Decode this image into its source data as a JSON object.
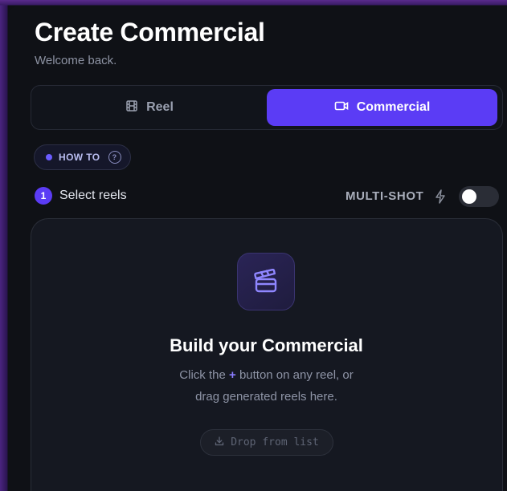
{
  "header": {
    "title": "Create Commercial",
    "subtitle": "Welcome back."
  },
  "mode_tabs": [
    {
      "label": "Reel",
      "icon": "film-icon",
      "selected": false
    },
    {
      "label": "Commercial",
      "icon": "video-camera-icon",
      "selected": true
    }
  ],
  "howto": {
    "label": "HOW TO",
    "help_icon": "question-circle-icon"
  },
  "step": {
    "number": "1",
    "label": "Select reels"
  },
  "multishot": {
    "label": "MULTI-SHOT",
    "icon": "lightning-bolt-icon",
    "enabled": false
  },
  "empty_state": {
    "icon": "clapperboard-icon",
    "title": "Build your Commercial",
    "hint_prefix": "Click the",
    "hint_plus": "+",
    "hint_suffix": "button on any reel, or",
    "hint_line2": "drag generated reels here.",
    "drop_button": "Drop from list",
    "drop_icon": "download-icon"
  },
  "colors": {
    "accent": "#5b3cf5",
    "background": "#0f1116",
    "card": "#151821"
  }
}
